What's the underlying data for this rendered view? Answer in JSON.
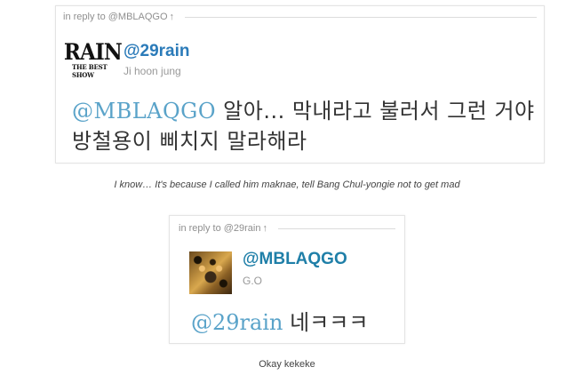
{
  "tweets": [
    {
      "reply_label": "in reply to @MBLAQGO",
      "reply_arrow": "↑",
      "avatar_text": "RAIN",
      "avatar_subtext": "THE BEST SHOW",
      "screen_name": "@29rain",
      "real_name": "Ji hoon jung",
      "mention": "@MBLAQGO",
      "ellipsis": "...",
      "text_after_mention_1": " 알아",
      "text_after_mention_2": " 막내라고 불러서 그런 거야 방철용이 삐치지 말라해라"
    },
    {
      "reply_label": "in reply to @29rain",
      "reply_arrow": "↑",
      "screen_name": "@MBLAQGO",
      "real_name": "G.O",
      "mention": "@29rain",
      "text_after_mention": " 네ㅋㅋㅋ"
    }
  ],
  "captions": [
    "I know… It's because I called him maknae, tell Bang Chul-yongie not to get mad",
    "Okay kekeke"
  ],
  "colors": {
    "screen_name": "#2b7bb9",
    "mention": "#5aa3c9",
    "muted": "#999999",
    "card_border": "#e4e4e4"
  }
}
